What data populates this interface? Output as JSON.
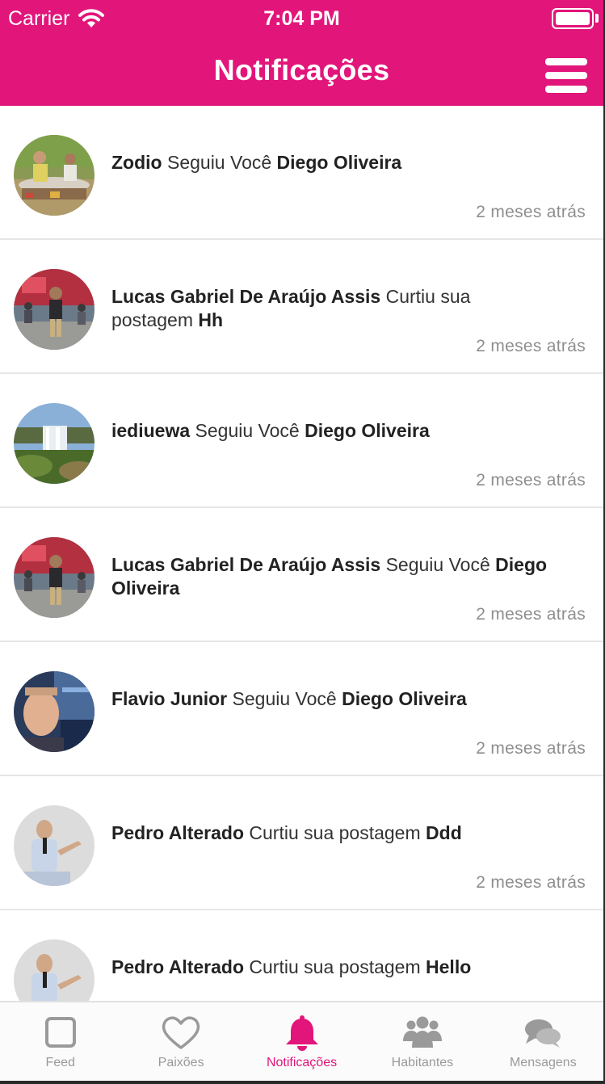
{
  "status_bar": {
    "carrier": "Carrier",
    "time": "7:04 PM"
  },
  "header": {
    "title": "Notificações"
  },
  "notifications": [
    {
      "actor": "Zodio",
      "action": "Seguiu Você",
      "object": "Diego Oliveira",
      "time_ago": "2 meses atrás"
    },
    {
      "actor": "Lucas Gabriel De Araújo Assis",
      "action": "Curtiu sua postagem",
      "object": "Hh",
      "time_ago": "2 meses atrás"
    },
    {
      "actor": "iediuewa",
      "action": "Seguiu Você",
      "object": "Diego Oliveira",
      "time_ago": "2 meses atrás"
    },
    {
      "actor": "Lucas Gabriel De Araújo Assis",
      "action": "Seguiu Você",
      "object": "Diego Oliveira",
      "time_ago": "2 meses atrás"
    },
    {
      "actor": "Flavio Junior",
      "action": "Seguiu Você",
      "object": "Diego Oliveira",
      "time_ago": "2 meses atrás"
    },
    {
      "actor": "Pedro Alterado",
      "action": "Curtiu sua postagem",
      "object": "Ddd",
      "time_ago": "2 meses atrás"
    },
    {
      "actor": "Pedro Alterado",
      "action": "Curtiu sua postagem",
      "object": "Hello",
      "time_ago": ""
    }
  ],
  "tabs": [
    {
      "label": "Feed",
      "icon": "square-icon"
    },
    {
      "label": "Paixões",
      "icon": "heart-icon"
    },
    {
      "label": "Notificações",
      "icon": "bell-icon",
      "active": true
    },
    {
      "label": "Habitantes",
      "icon": "people-icon"
    },
    {
      "label": "Mensagens",
      "icon": "chat-bubbles-icon"
    }
  ],
  "colors": {
    "accent": "#e2157a",
    "inactive": "#9a9a9a",
    "text": "#333333",
    "muted": "#8e8e8e"
  }
}
